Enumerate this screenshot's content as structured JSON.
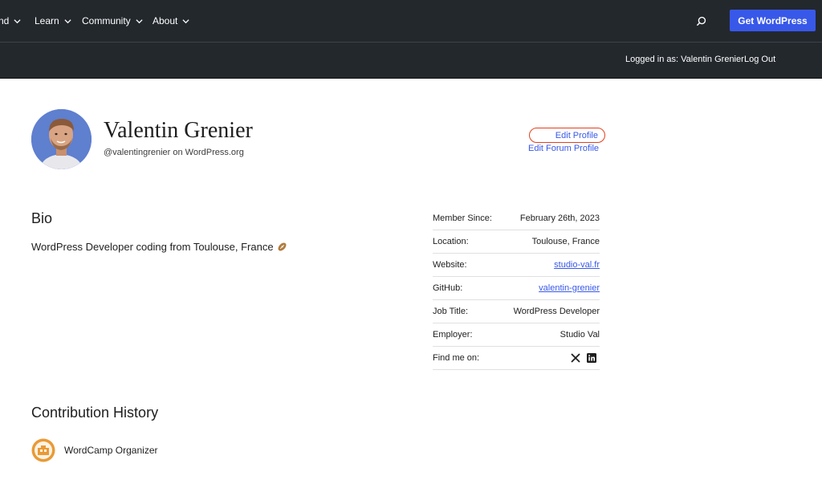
{
  "nav": {
    "items": [
      {
        "label": "nd"
      },
      {
        "label": "Learn"
      },
      {
        "label": "Community"
      },
      {
        "label": "About"
      }
    ],
    "search_icon": "search-icon",
    "cta_label": "Get WordPress",
    "colors": {
      "background": "#23282d",
      "cta": "#3858e9"
    }
  },
  "subbar": {
    "logged_in_text": "Logged in as: Valentin Grenier",
    "logout_label": "Log Out"
  },
  "profile": {
    "name": "Valentin Grenier",
    "handle": "@valentingrenier on WordPress.org",
    "edit_profile_label": "Edit Profile",
    "edit_forum_label": "Edit Forum Profile",
    "highlight_color": "#e2401c"
  },
  "bio": {
    "heading": "Bio",
    "text": "WordPress Developer coding from Toulouse, France"
  },
  "meta": {
    "rows": [
      {
        "label": "Member Since:",
        "value": "February 26th, 2023"
      },
      {
        "label": "Location:",
        "value": "Toulouse, France"
      },
      {
        "label": "Website:",
        "value": "studio-val.fr"
      },
      {
        "label": "GitHub:",
        "value": "valentin-grenier"
      },
      {
        "label": "Job Title:",
        "value": "WordPress Developer"
      },
      {
        "label": "Employer:",
        "value": "Studio Val"
      },
      {
        "label": "Find me on:"
      }
    ],
    "social_icons": [
      "x-icon",
      "linkedin-icon"
    ]
  },
  "contributions": {
    "heading": "Contribution History",
    "items": [
      {
        "label": "WordCamp Organizer",
        "icon": "wordcamp-badge-icon"
      }
    ]
  }
}
